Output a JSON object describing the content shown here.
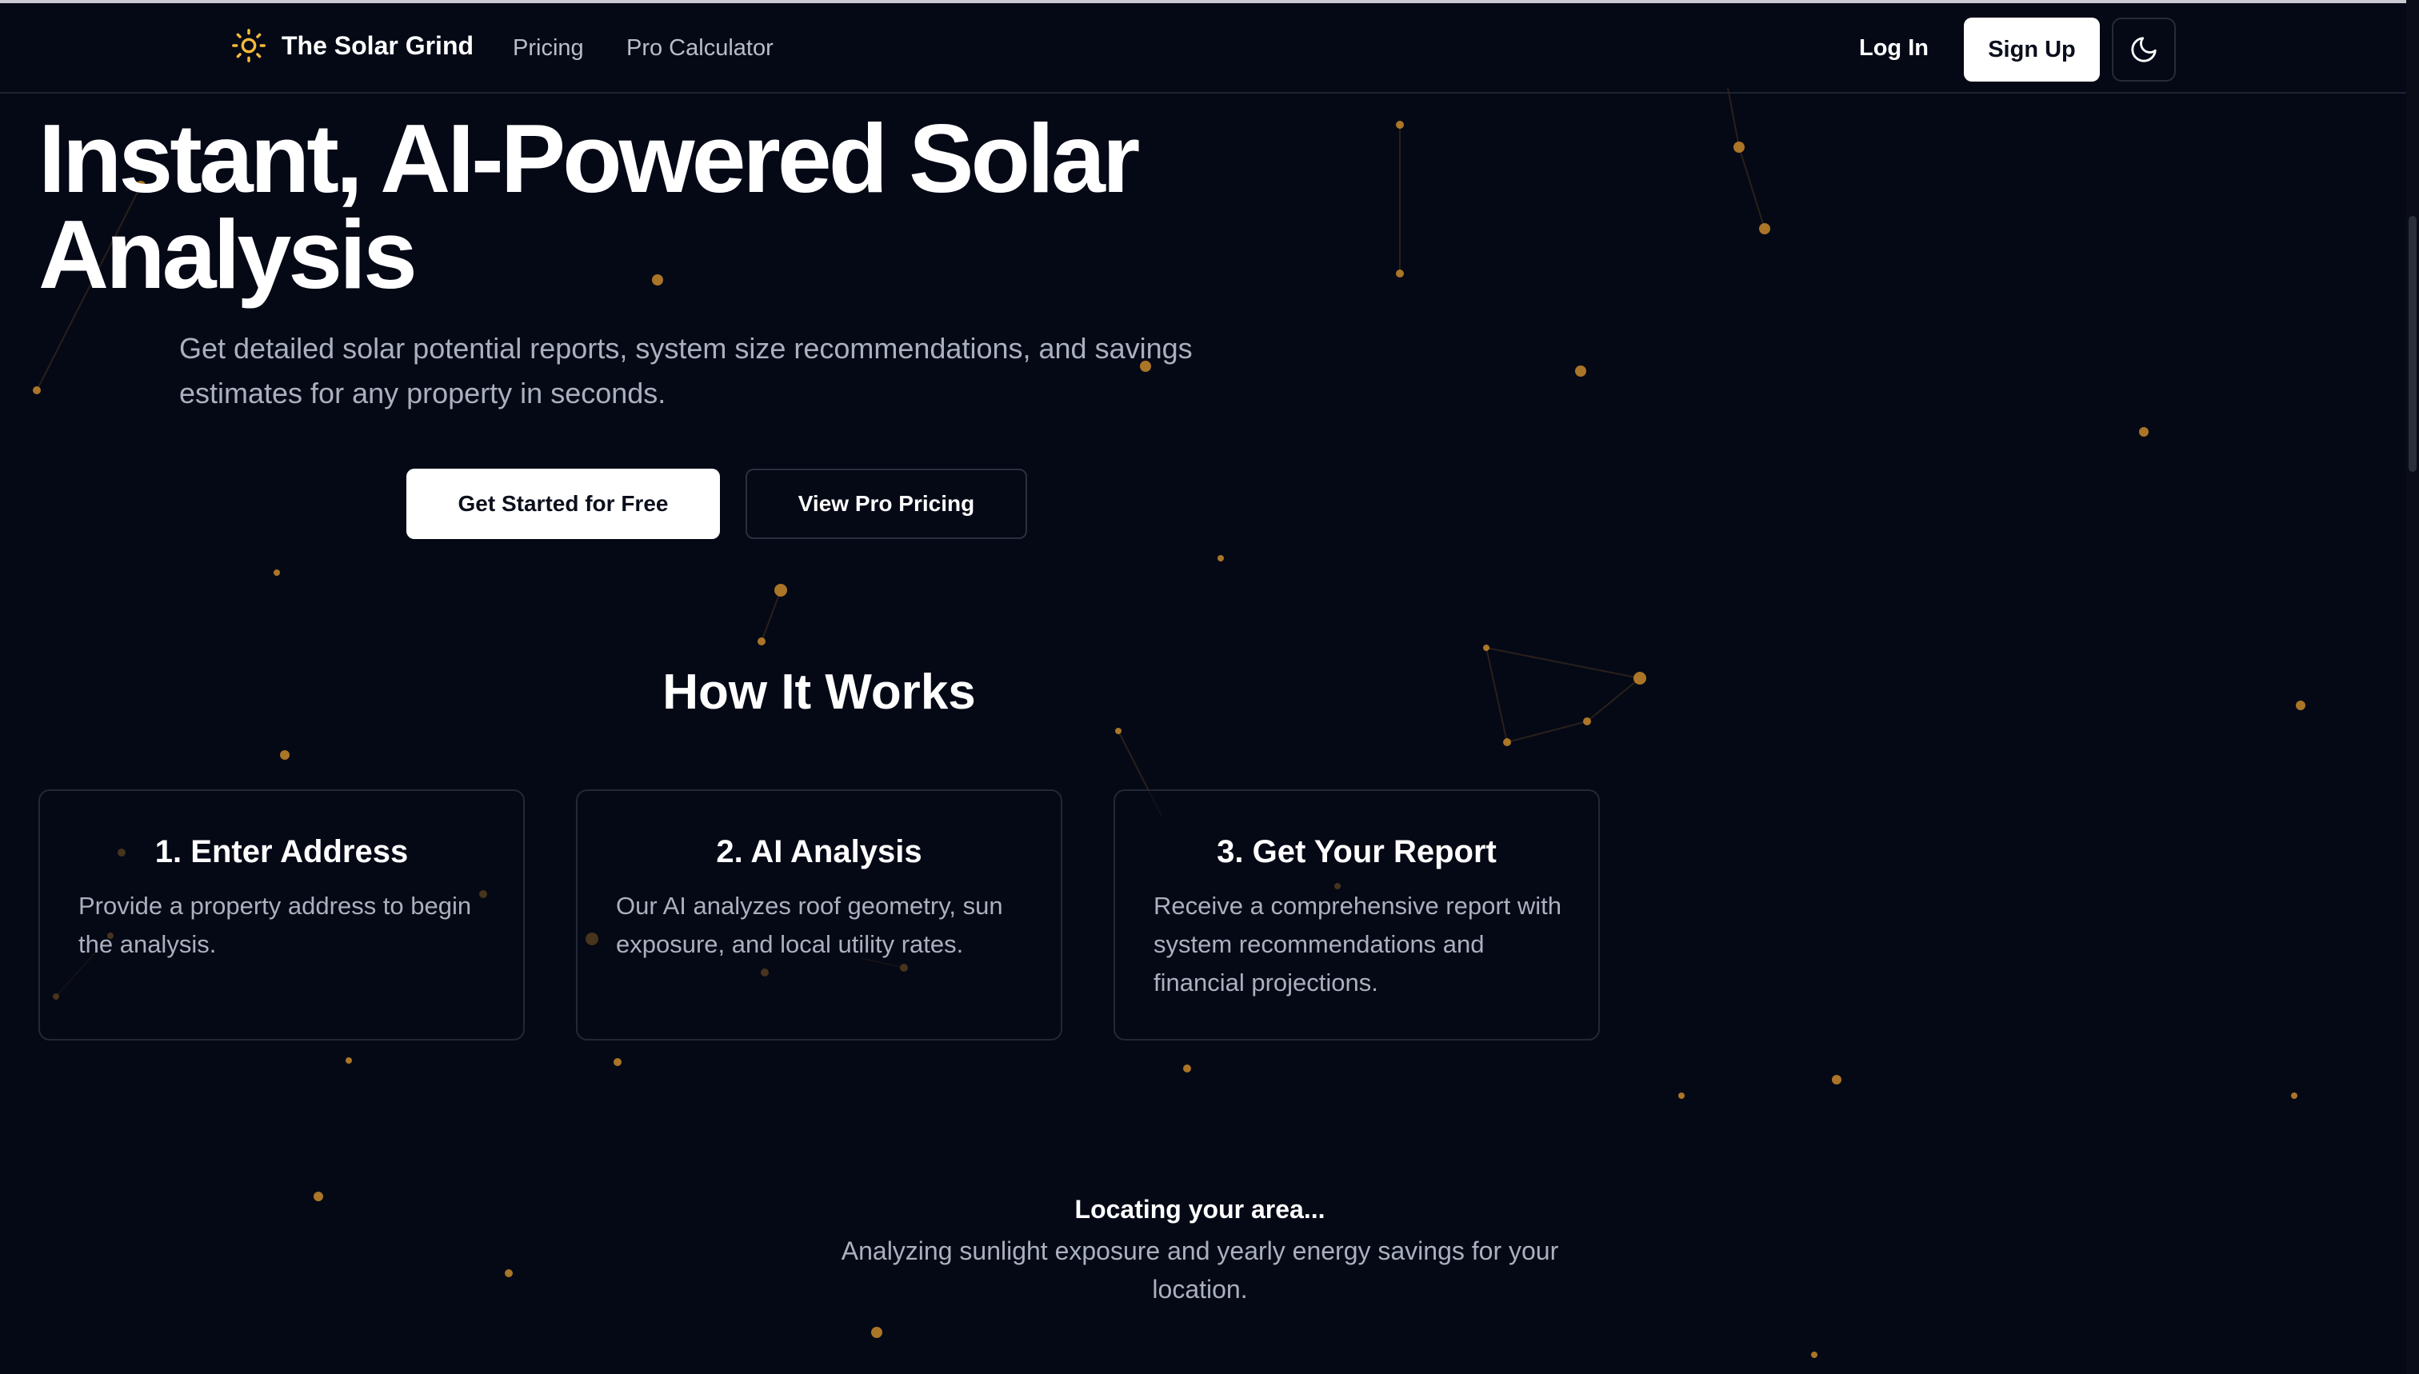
{
  "brand": {
    "name": "The Solar Grind",
    "icon": "sun-icon",
    "accent": "#f5b93a"
  },
  "nav": {
    "links": [
      "Pricing",
      "Pro Calculator"
    ],
    "login": "Log In",
    "signup": "Sign Up",
    "theme_icon": "moon-icon"
  },
  "hero": {
    "title": "Instant, AI-Powered Solar Analysis",
    "subtitle": "Get detailed solar potential reports, system size recommendations, and savings estimates for any property in seconds.",
    "primary_cta": "Get Started for Free",
    "secondary_cta": "View Pro Pricing"
  },
  "how_it_works": {
    "title": "How It Works",
    "steps": [
      {
        "title": "1. Enter Address",
        "desc": "Provide a property address to begin the analysis."
      },
      {
        "title": "2. AI Analysis",
        "desc": "Our AI analyzes roof geometry, sun exposure, and local utility rates."
      },
      {
        "title": "3. Get Your Report",
        "desc": "Receive a comprehensive report with system recommendations and financial projections."
      }
    ]
  },
  "location": {
    "title": "Locating your area...",
    "subtitle": "Analyzing sunlight exposure and yearly energy savings for your location."
  },
  "colors": {
    "background": "#050916",
    "particle": "#c8882a",
    "muted_text": "#aab0bf"
  }
}
